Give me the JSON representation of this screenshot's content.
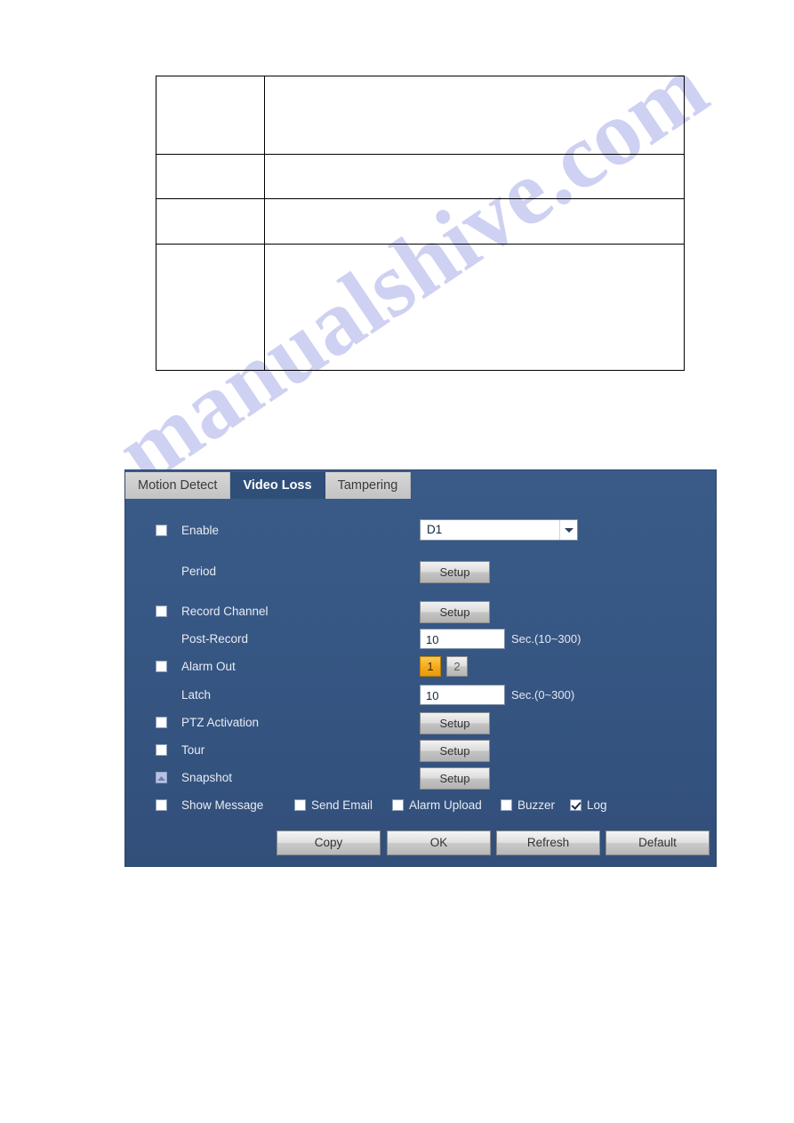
{
  "document": {
    "watermark": "manualshive.com",
    "spec_table": {
      "rows": [
        {
          "label": "",
          "description": ""
        },
        {
          "label": "",
          "description": ""
        },
        {
          "label": "",
          "description": ""
        },
        {
          "label": "",
          "description": ""
        }
      ]
    }
  },
  "panel": {
    "tabs": [
      {
        "label": "Motion Detect",
        "active": false
      },
      {
        "label": "Video Loss",
        "active": true
      },
      {
        "label": "Tampering",
        "active": false
      }
    ],
    "fields": {
      "enable": {
        "label": "Enable",
        "checked": false
      },
      "channel": {
        "value": "D1"
      },
      "period": {
        "label": "Period",
        "button": "Setup"
      },
      "record_channel": {
        "label": "Record Channel",
        "checked": false,
        "button": "Setup"
      },
      "post_record": {
        "label": "Post-Record",
        "value": "10",
        "unit": "Sec.(10~300)"
      },
      "alarm_out": {
        "label": "Alarm Out",
        "checked": false,
        "options": [
          "1",
          "2"
        ],
        "selected": "1"
      },
      "latch": {
        "label": "Latch",
        "value": "10",
        "unit": "Sec.(0~300)"
      },
      "ptz_activation": {
        "label": "PTZ Activation",
        "checked": false,
        "button": "Setup"
      },
      "tour": {
        "label": "Tour",
        "checked": false,
        "button": "Setup"
      },
      "snapshot": {
        "label": "Snapshot",
        "checked": false,
        "button": "Setup"
      },
      "show_message": {
        "label": "Show Message",
        "checked": false
      },
      "send_email": {
        "label": "Send Email",
        "checked": false
      },
      "alarm_upload": {
        "label": "Alarm Upload",
        "checked": false
      },
      "buzzer": {
        "label": "Buzzer",
        "checked": false
      },
      "log": {
        "label": "Log",
        "checked": true
      }
    },
    "footer": {
      "copy": "Copy",
      "ok": "OK",
      "refresh": "Refresh",
      "default": "Default"
    },
    "colors": {
      "panel_bg": "#365683",
      "active_tab_bg": "#2f4f79",
      "inactive_tab_bg": "#cccccc",
      "alarm_selected": "#f5a81c",
      "button_face": "#dcdcdc"
    }
  }
}
